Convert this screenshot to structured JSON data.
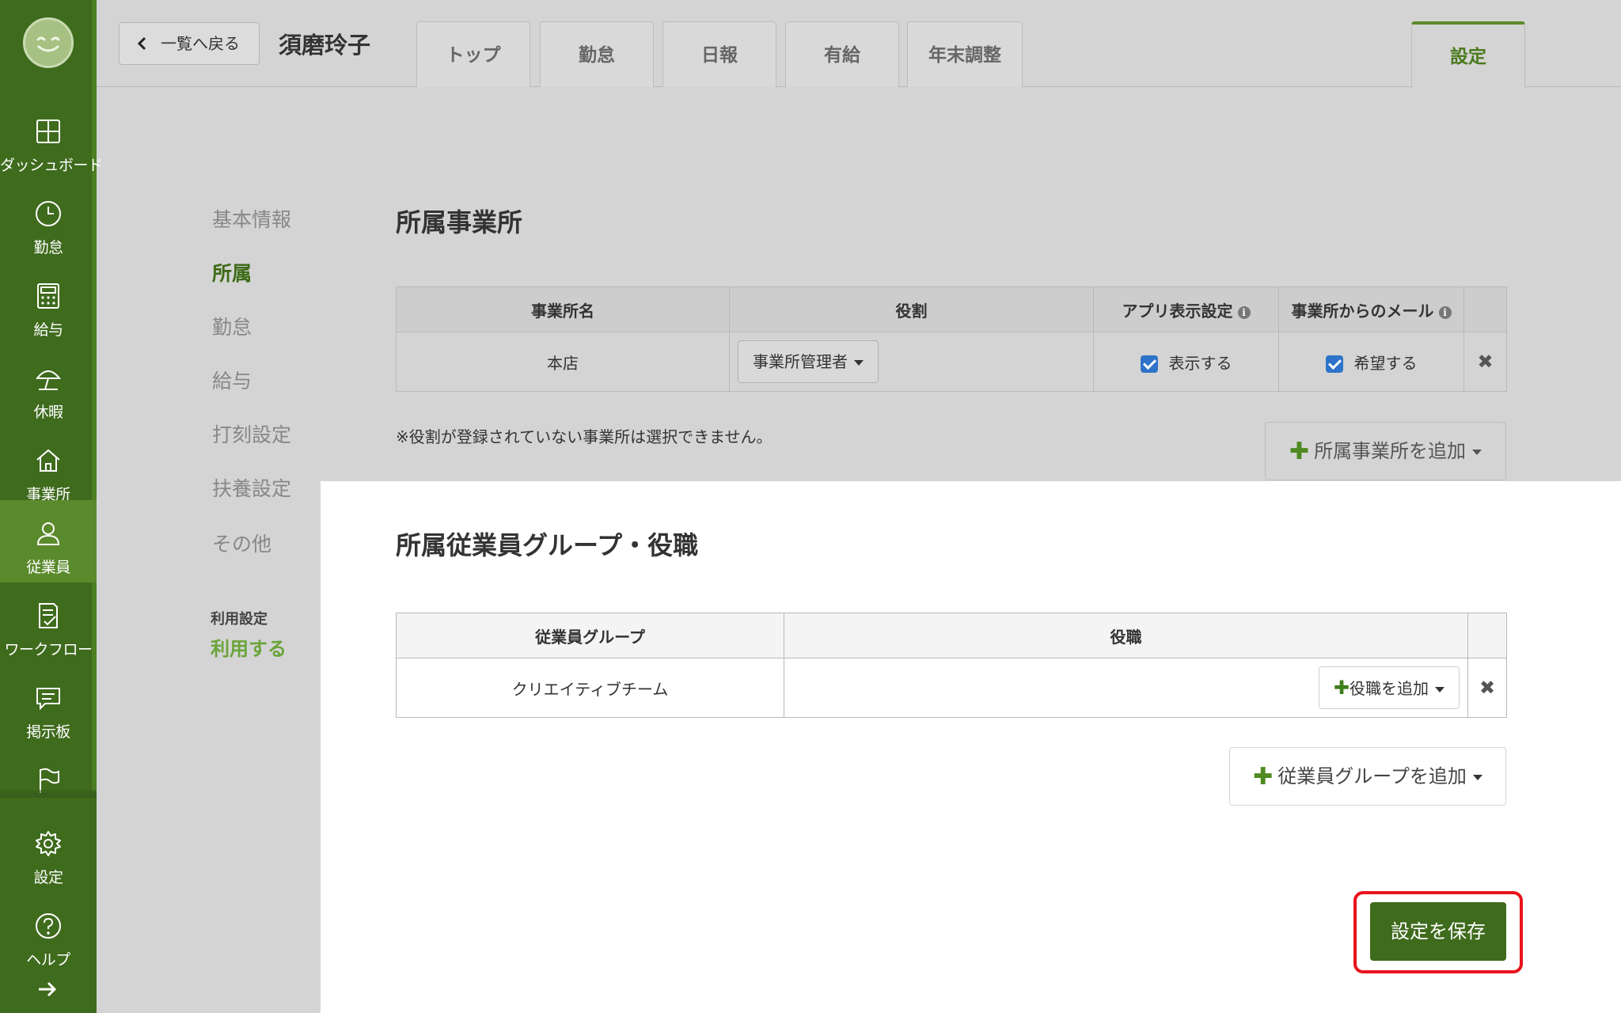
{
  "sidebar": {
    "items": [
      {
        "label": "ダッシュボード",
        "icon": "dashboard-icon"
      },
      {
        "label": "勤怠",
        "icon": "clock-icon"
      },
      {
        "label": "給与",
        "icon": "calculator-icon"
      },
      {
        "label": "休暇",
        "icon": "umbrella-icon"
      },
      {
        "label": "事業所",
        "icon": "home-icon"
      },
      {
        "label": "従業員",
        "icon": "person-icon",
        "active": true
      },
      {
        "label": "ワークフロー",
        "icon": "document-check-icon"
      },
      {
        "label": "掲示板",
        "icon": "message-icon"
      },
      {
        "label": "",
        "icon": "flag-icon"
      },
      {
        "label": "設定",
        "icon": "gear-icon"
      },
      {
        "label": "ヘルプ",
        "icon": "help-icon"
      }
    ]
  },
  "header": {
    "back_label": "一覧へ戻る",
    "employee_name": "須磨玲子",
    "tabs": [
      {
        "label": "トップ"
      },
      {
        "label": "勤怠"
      },
      {
        "label": "日報"
      },
      {
        "label": "有給"
      },
      {
        "label": "年末調整"
      },
      {
        "label": "設定",
        "active": true
      }
    ]
  },
  "subnav": {
    "items": [
      "基本情報",
      "所属",
      "勤怠",
      "給与",
      "打刻設定",
      "扶養設定",
      "その他"
    ],
    "active": "所属",
    "usage_title": "利用設定",
    "usage_value": "利用する"
  },
  "offices": {
    "title": "所属事業所",
    "columns": [
      "事業所名",
      "役割",
      "アプリ表示設定",
      "事業所からのメール"
    ],
    "rows": [
      {
        "name": "本店",
        "role": "事業所管理者",
        "app_display": "表示する",
        "mail": "希望する"
      }
    ],
    "note": "※役割が登録されていない事業所は選択できません。",
    "add_label": "所属事業所を追加"
  },
  "groups": {
    "title": "所属従業員グループ・役職",
    "columns": [
      "従業員グループ",
      "役職"
    ],
    "rows": [
      {
        "group": "クリエイティブチーム",
        "add_role_label": "役職を追加"
      }
    ],
    "add_label": "従業員グループを追加"
  },
  "save_label": "設定を保存",
  "colors": {
    "sidebar": "#3f6b1d",
    "accent": "#5b8a2c",
    "save_button": "#3f6b1d",
    "highlight_border": "#e8131b",
    "checkbox": "#2e73c9"
  }
}
